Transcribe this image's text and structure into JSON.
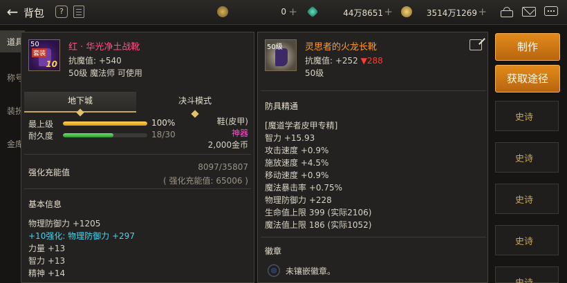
{
  "topbar": {
    "title": "背包",
    "help": "?",
    "currency1_value": "0",
    "currency2_value": "44万8651",
    "currency3_value": "3514万1269",
    "plus": "+"
  },
  "left_tabs": [
    "道具",
    "称号",
    "装扮",
    "金库"
  ],
  "actions": {
    "make": "制作",
    "obtain": "获取途径"
  },
  "bg_list": [
    "史诗",
    "史诗",
    "史诗",
    "史诗",
    "史诗"
  ],
  "item1": {
    "level_badge": "50",
    "tag": "套装",
    "plus_num": "10",
    "name": "红 · 华光净土战靴",
    "resist": "抗魔值: +540",
    "req": "50级 魔法师 可使用",
    "modes": [
      "地下城",
      "决斗模式"
    ],
    "grade_label": "最上级",
    "grade_value": "100%",
    "grade_fraction": 1.0,
    "dur_label": "耐久度",
    "dur_value": "18/30",
    "dur_fraction": 0.6,
    "type": "鞋(皮甲)",
    "rarity": "神器",
    "price": "2,000金币",
    "charge_title": "强化充能值",
    "charge_value": "8097/35807",
    "charge_sub": "( 强化充能值: 65006 )",
    "basic_title": "基本信息",
    "stats": [
      {
        "text": "物理防御力 +1205",
        "color": "normal"
      },
      {
        "text": "+10强化: 物理防御力 +297",
        "color": "cyan"
      },
      {
        "text": "力量 +13",
        "color": "normal"
      },
      {
        "text": "智力 +13",
        "color": "normal"
      },
      {
        "text": "精神 +14",
        "color": "normal"
      }
    ]
  },
  "item2": {
    "level_badge": "50级",
    "name": "灵思者的火龙长靴",
    "resist_prefix": "抗魔值: +252",
    "resist_diff": "▼288",
    "req": "50级",
    "mastery_title": "防具精通",
    "stats": [
      "[魔道学者皮甲专精]",
      "智力 +15.93",
      "攻击速度 +0.9%",
      "施放速度 +4.5%",
      "移动速度 +0.9%",
      "魔法暴击率 +0.75%",
      "物理防御力 +228",
      "生命值上限 399 (实际2106)",
      "魔法值上限 186 (实际1052)"
    ],
    "emblem_title": "徽章",
    "emblem_text": "未镶嵌徽章。"
  },
  "colors": {
    "accent_orange": "#e28a1b",
    "name_pink": "#ff4f8b",
    "name_orange": "#ff9a2e",
    "cyan": "#46d4f0",
    "grade_bar": "#f0b323",
    "dur_bar": "#3fbf3f"
  }
}
